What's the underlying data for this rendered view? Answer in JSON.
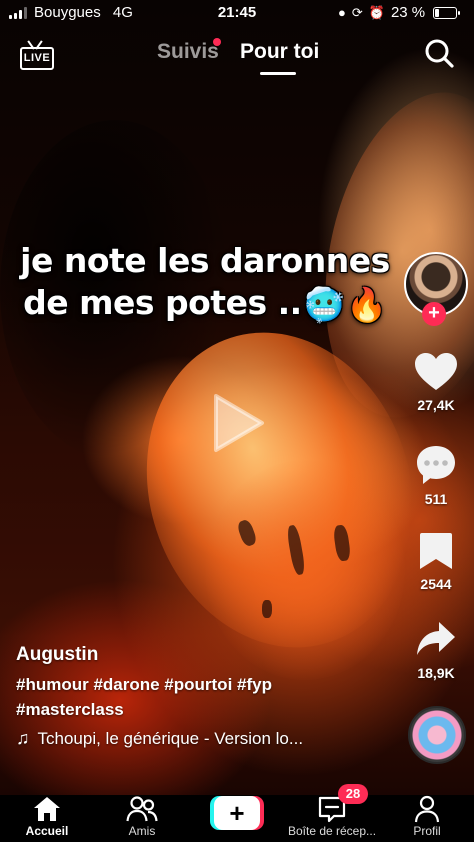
{
  "status_bar": {
    "carrier": "Bouygues",
    "network": "4G",
    "time": "21:45",
    "battery_percent": "23 %",
    "battery_level": 0.23,
    "icons": [
      "person-icon",
      "rotation-lock-icon",
      "alarm-icon"
    ]
  },
  "top_nav": {
    "live_label": "LIVE",
    "tabs": [
      {
        "label": "Suivis",
        "active": false,
        "has_notification_dot": true
      },
      {
        "label": "Pour toi",
        "active": true
      }
    ]
  },
  "video": {
    "overlay_text_line1": "je note les daronnes",
    "overlay_text_line2": "de mes potes ..",
    "overlay_emojis": [
      "🥶",
      "🔥"
    ]
  },
  "actions": {
    "follow_symbol": "+",
    "likes": "27,4K",
    "comments": "511",
    "favorites": "2544",
    "shares": "18,9K"
  },
  "post": {
    "username": "Augustin",
    "description_line1": "#humour #darone #pourtoi #fyp",
    "description_line2": "#masterclass",
    "sound": "Tchoupi, le générique - Version lo..."
  },
  "bottom_nav": {
    "items": [
      {
        "label": "Accueil",
        "icon": "home-icon",
        "active": true
      },
      {
        "label": "Amis",
        "icon": "friends-icon",
        "active": false
      },
      {
        "label": "",
        "icon": "create-icon",
        "active": false
      },
      {
        "label": "Boîte de récep...",
        "icon": "inbox-icon",
        "active": false
      },
      {
        "label": "Profil",
        "icon": "profile-icon",
        "active": false
      }
    ],
    "create_symbol": "+",
    "inbox_badge": "28"
  },
  "colors": {
    "accent_red": "#fe2c55",
    "accent_cyan": "#25f4ee",
    "background": "#000000"
  }
}
